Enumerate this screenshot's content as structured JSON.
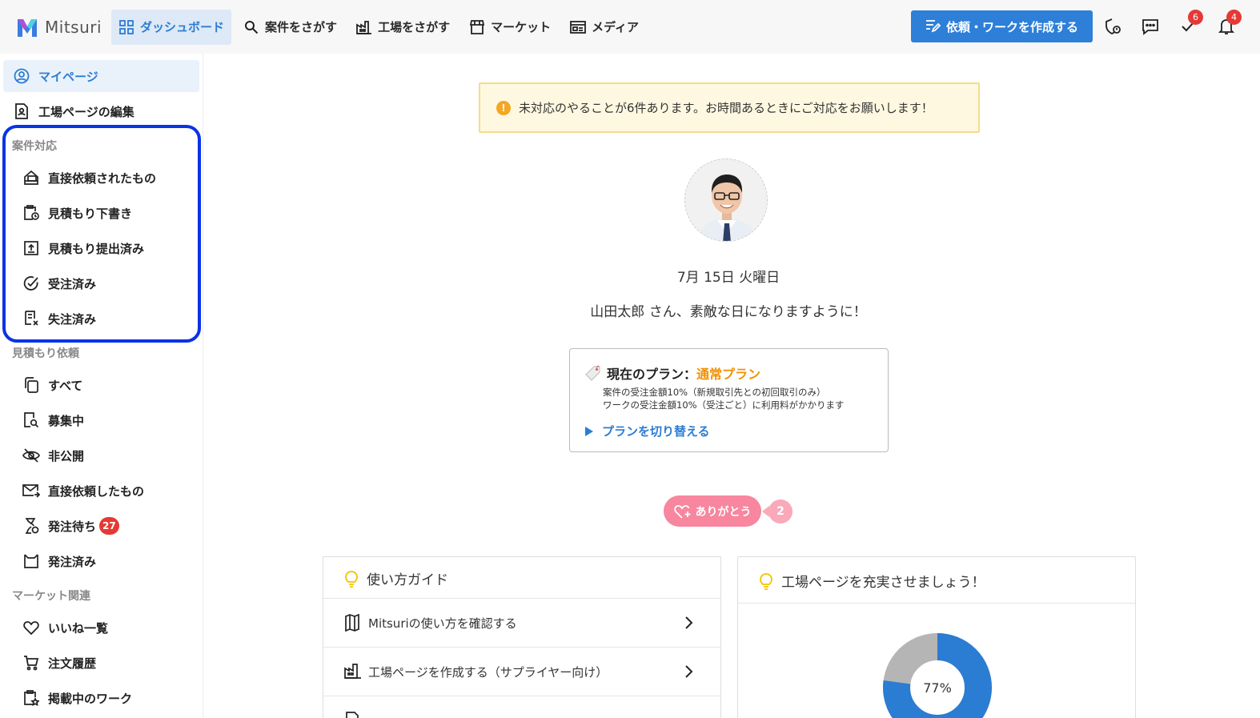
{
  "brand": {
    "name": "Mitsuri"
  },
  "nav": [
    {
      "label": "ダッシュボード",
      "icon": "grid-icon",
      "active": true
    },
    {
      "label": "案件をさがす",
      "icon": "search-icon"
    },
    {
      "label": "工場をさがす",
      "icon": "factory-icon"
    },
    {
      "label": "マーケット",
      "icon": "store-icon"
    },
    {
      "label": "メディア",
      "icon": "newspaper-icon"
    }
  ],
  "header": {
    "create_label": "依頼・ワークを作成する",
    "tasks_badge": "6",
    "notifications_badge": "4"
  },
  "sidebar": {
    "top": [
      {
        "label": "マイページ",
        "active": true
      },
      {
        "label": "工場ページの編集"
      }
    ],
    "sections": [
      {
        "heading": "案件対応",
        "items": [
          {
            "label": "直接依頼されたもの"
          },
          {
            "label": "見積もり下書き"
          },
          {
            "label": "見積もり提出済み"
          },
          {
            "label": "受注済み"
          },
          {
            "label": "失注済み"
          }
        ]
      },
      {
        "heading": "見積もり依頼",
        "items": [
          {
            "label": "すべて"
          },
          {
            "label": "募集中"
          },
          {
            "label": "非公開"
          },
          {
            "label": "直接依頼したもの"
          },
          {
            "label": "発注待ち",
            "badge": "27"
          },
          {
            "label": "発注済み"
          }
        ]
      },
      {
        "heading": "マーケット関連",
        "items": [
          {
            "label": "いいね一覧"
          },
          {
            "label": "注文履歴"
          },
          {
            "label": "掲載中のワーク"
          }
        ]
      }
    ]
  },
  "main": {
    "alert": "未対応のやることが6件あります。お時間あるときにご対応をお願いします！",
    "date": "7月 15日 火曜日",
    "greeting": "山田太郎 さん、素敵な日になりますように！",
    "plan": {
      "title_prefix": "現在のプラン：",
      "plan_name": "通常プラン",
      "desc1": "案件の受注金額10%（新規取引先との初回取引のみ）",
      "desc2": "ワークの受注金額10%（受注ごと）に利用料がかかります",
      "switch_label": "プランを切り替える"
    },
    "thanks": {
      "label": "ありがとう",
      "count": "2"
    },
    "guide": {
      "title": "使い方ガイド",
      "rows": [
        "Mitsuriの使い方を確認する",
        "工場ページを作成する（サプライヤー向け）"
      ]
    },
    "completion": {
      "title": "工場ページを充実させましょう！",
      "percent_label": "77%",
      "percent": 77
    }
  },
  "colors": {
    "accent": "#2d7fd8",
    "highlight": "#0a33e6",
    "plan": "#f29100",
    "thanks": "#f7869e"
  }
}
